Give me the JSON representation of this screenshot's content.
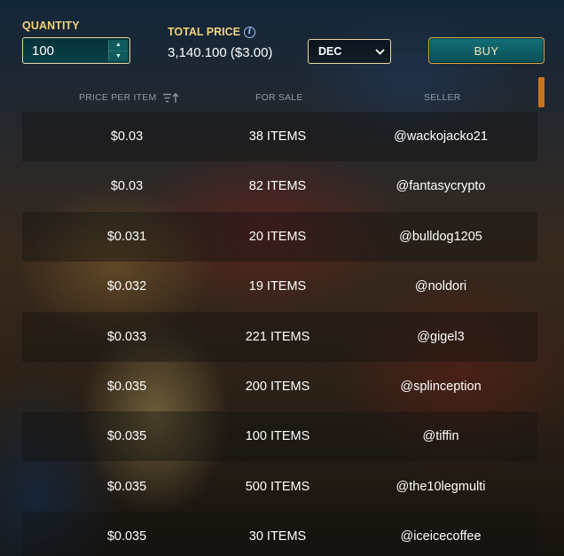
{
  "quantity": {
    "label": "QUANTITY",
    "value": "100"
  },
  "total": {
    "label": "TOTAL PRICE",
    "value": "3,140.100 ($3.00)"
  },
  "currency": {
    "selected": "DEC"
  },
  "buy": {
    "label": "BUY"
  },
  "table": {
    "headers": {
      "price": "PRICE PER ITEM",
      "for_sale": "FOR SALE",
      "seller": "SELLER"
    },
    "rows": [
      {
        "price": "$0.03",
        "for_sale": "38 ITEMS",
        "seller": "@wackojacko21"
      },
      {
        "price": "$0.03",
        "for_sale": "82 ITEMS",
        "seller": "@fantasycrypto"
      },
      {
        "price": "$0.031",
        "for_sale": "20 ITEMS",
        "seller": "@bulldog1205"
      },
      {
        "price": "$0.032",
        "for_sale": "19 ITEMS",
        "seller": "@noldori"
      },
      {
        "price": "$0.033",
        "for_sale": "221 ITEMS",
        "seller": "@gigel3"
      },
      {
        "price": "$0.035",
        "for_sale": "200 ITEMS",
        "seller": "@splinception"
      },
      {
        "price": "$0.035",
        "for_sale": "100 ITEMS",
        "seller": "@tiffin"
      },
      {
        "price": "$0.035",
        "for_sale": "500 ITEMS",
        "seller": "@the10legmulti"
      },
      {
        "price": "$0.035",
        "for_sale": "30 ITEMS",
        "seller": "@iceicecoffee"
      }
    ]
  },
  "icons": {
    "info": "info-icon",
    "sort": "sort-ascending-icon",
    "dropdown": "chevron-down-icon",
    "stepper_up": "caret-up-icon",
    "stepper_down": "caret-down-icon"
  },
  "colors": {
    "label_gold": "#f1d27c",
    "input_border": "#e9d6a0",
    "buy_fill": "#127177",
    "buy_border": "#d9a54a",
    "scrollbar": "#c8741c",
    "header_text": "#8f9aa8"
  }
}
